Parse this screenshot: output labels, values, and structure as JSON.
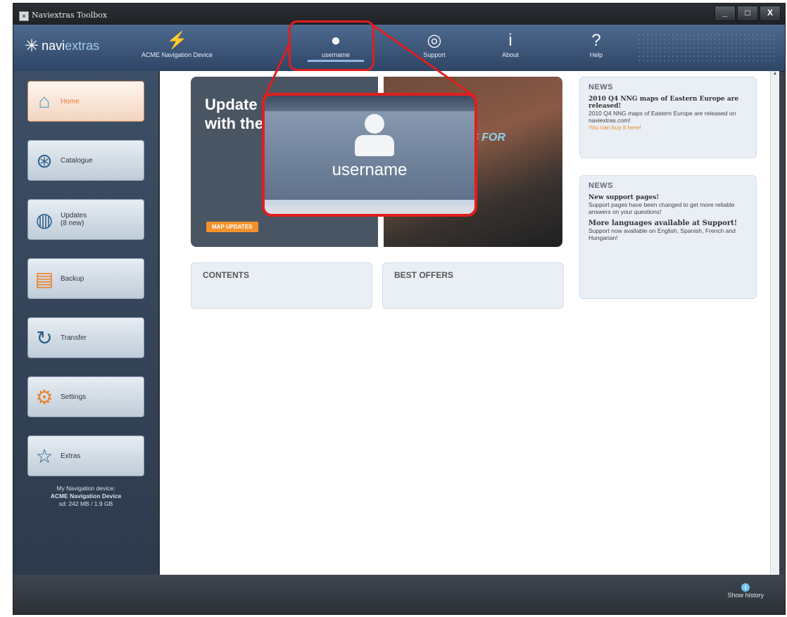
{
  "window": {
    "title": "Naviextras Toolbox",
    "controls": [
      "_",
      "□",
      "X"
    ]
  },
  "logo": {
    "text_a": "navi",
    "text_b": "extras"
  },
  "nav": [
    {
      "label": "ACME Navigation Device",
      "icon": "plug-icon"
    },
    {
      "label": "username",
      "icon": "user-icon"
    },
    {
      "label": "Support",
      "icon": "lifebuoy-icon"
    },
    {
      "label": "About",
      "icon": "info-icon"
    },
    {
      "label": "Help",
      "icon": "question-icon"
    }
  ],
  "sidebar": {
    "items": [
      {
        "label": "Home",
        "icon": "home-icon"
      },
      {
        "label": "Catalogue",
        "icon": "compass-icon"
      },
      {
        "label": "Updates\n(8 new)",
        "icon": "globe-refresh-icon"
      },
      {
        "label": "Backup",
        "icon": "backup-icon"
      },
      {
        "label": "Transfer",
        "icon": "transfer-icon"
      },
      {
        "label": "Settings",
        "icon": "gears-icon"
      },
      {
        "label": "Extras",
        "icon": "star-icon"
      }
    ],
    "device": {
      "line1": "My Navigation device:",
      "line2": "ACME Navigation Device",
      "line3": "sd: 242 MB / 1.9 GB"
    }
  },
  "hero": {
    "headline": "Update your maps with the latest",
    "cta": "MAP UPDATES",
    "sign": "S FOR"
  },
  "panels": {
    "contents": "CONTENTS",
    "offers": "BEST OFFERS"
  },
  "news": [
    {
      "title": "NEWS",
      "head": "2010 Q4 NNG maps of Eastern Europe are released!",
      "body": "2010 Q4 NNG maps of Eastern Europe are released on naviextras.com!",
      "link": "You can buy it here!"
    },
    {
      "title": "NEWS",
      "head": "New support pages!",
      "body": "Support pages have been changed to get more reliable answers on your questions!",
      "head2": "More languages available at Support!",
      "body2": "Support now available on English, Spanish, French and Hungarian!"
    }
  ],
  "footer": {
    "show_history": "Show history"
  },
  "callout": {
    "username": "username"
  }
}
